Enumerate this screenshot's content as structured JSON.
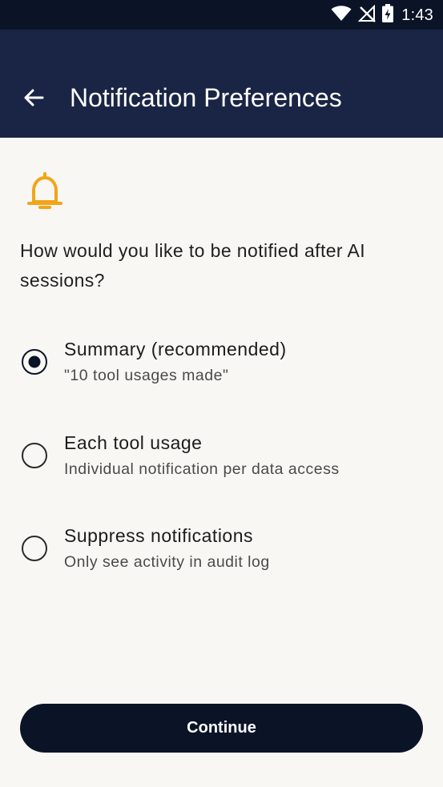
{
  "status_bar": {
    "time": "1:43",
    "icons": [
      "wifi-icon",
      "no-signal-icon",
      "battery-charging-icon"
    ]
  },
  "header": {
    "back_icon": "arrow-back-icon",
    "title": "Notification Preferences"
  },
  "content": {
    "icon": "bell-icon",
    "question": "How would you like to be notified after AI sessions?",
    "selected_option": "summary",
    "options": [
      {
        "id": "summary",
        "title": "Summary (recommended)",
        "subtitle": "\"10 tool usages made\"",
        "selected": true
      },
      {
        "id": "each",
        "title": "Each tool usage",
        "subtitle": "Individual notification per data access",
        "selected": false
      },
      {
        "id": "suppress",
        "title": "Suppress notifications",
        "subtitle": "Only see activity in audit log",
        "selected": false
      }
    ]
  },
  "actions": {
    "continue_label": "Continue"
  },
  "colors": {
    "status_bar": "#0b1327",
    "header": "#1a2545",
    "background": "#f8f7f4",
    "accent_bell": "#f2a418",
    "primary": "#0b1327"
  }
}
